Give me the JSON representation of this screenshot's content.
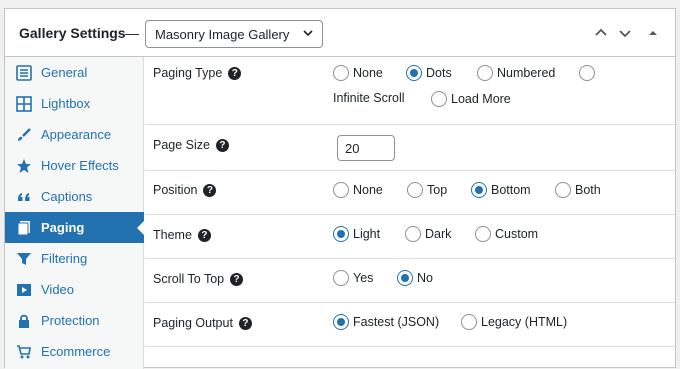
{
  "header": {
    "title": "Gallery Settings",
    "dash": "—",
    "gallery_select": "Masonry Image Gallery"
  },
  "sidebar": {
    "items": [
      {
        "label": "General",
        "icon": "sliders-icon"
      },
      {
        "label": "Lightbox",
        "icon": "grid-icon"
      },
      {
        "label": "Appearance",
        "icon": "brush-icon"
      },
      {
        "label": "Hover Effects",
        "icon": "star-icon"
      },
      {
        "label": "Captions",
        "icon": "quote-icon"
      },
      {
        "label": "Paging",
        "icon": "pages-icon"
      },
      {
        "label": "Filtering",
        "icon": "filter-icon"
      },
      {
        "label": "Video",
        "icon": "video-icon"
      },
      {
        "label": "Protection",
        "icon": "lock-icon"
      },
      {
        "label": "Ecommerce",
        "icon": "cart-icon"
      }
    ],
    "active": "Paging"
  },
  "settings": {
    "paging_type": {
      "label": "Paging Type",
      "options": [
        "None",
        "Dots",
        "Numbered",
        "Infinite Scroll",
        "Load More"
      ],
      "selected": "Dots"
    },
    "page_size": {
      "label": "Page Size",
      "value": "20"
    },
    "position": {
      "label": "Position",
      "options": [
        "None",
        "Top",
        "Bottom",
        "Both"
      ],
      "selected": "Bottom"
    },
    "theme": {
      "label": "Theme",
      "options": [
        "Light",
        "Dark",
        "Custom"
      ],
      "selected": "Light"
    },
    "scroll_to_top": {
      "label": "Scroll To Top",
      "options": [
        "Yes",
        "No"
      ],
      "selected": "No"
    },
    "paging_output": {
      "label": "Paging Output",
      "options": [
        "Fastest (JSON)",
        "Legacy (HTML)"
      ],
      "selected": "Fastest (JSON)"
    }
  },
  "colors": {
    "accent": "#2271b1",
    "text": "#1d2327",
    "border": "#c3c4c7"
  }
}
